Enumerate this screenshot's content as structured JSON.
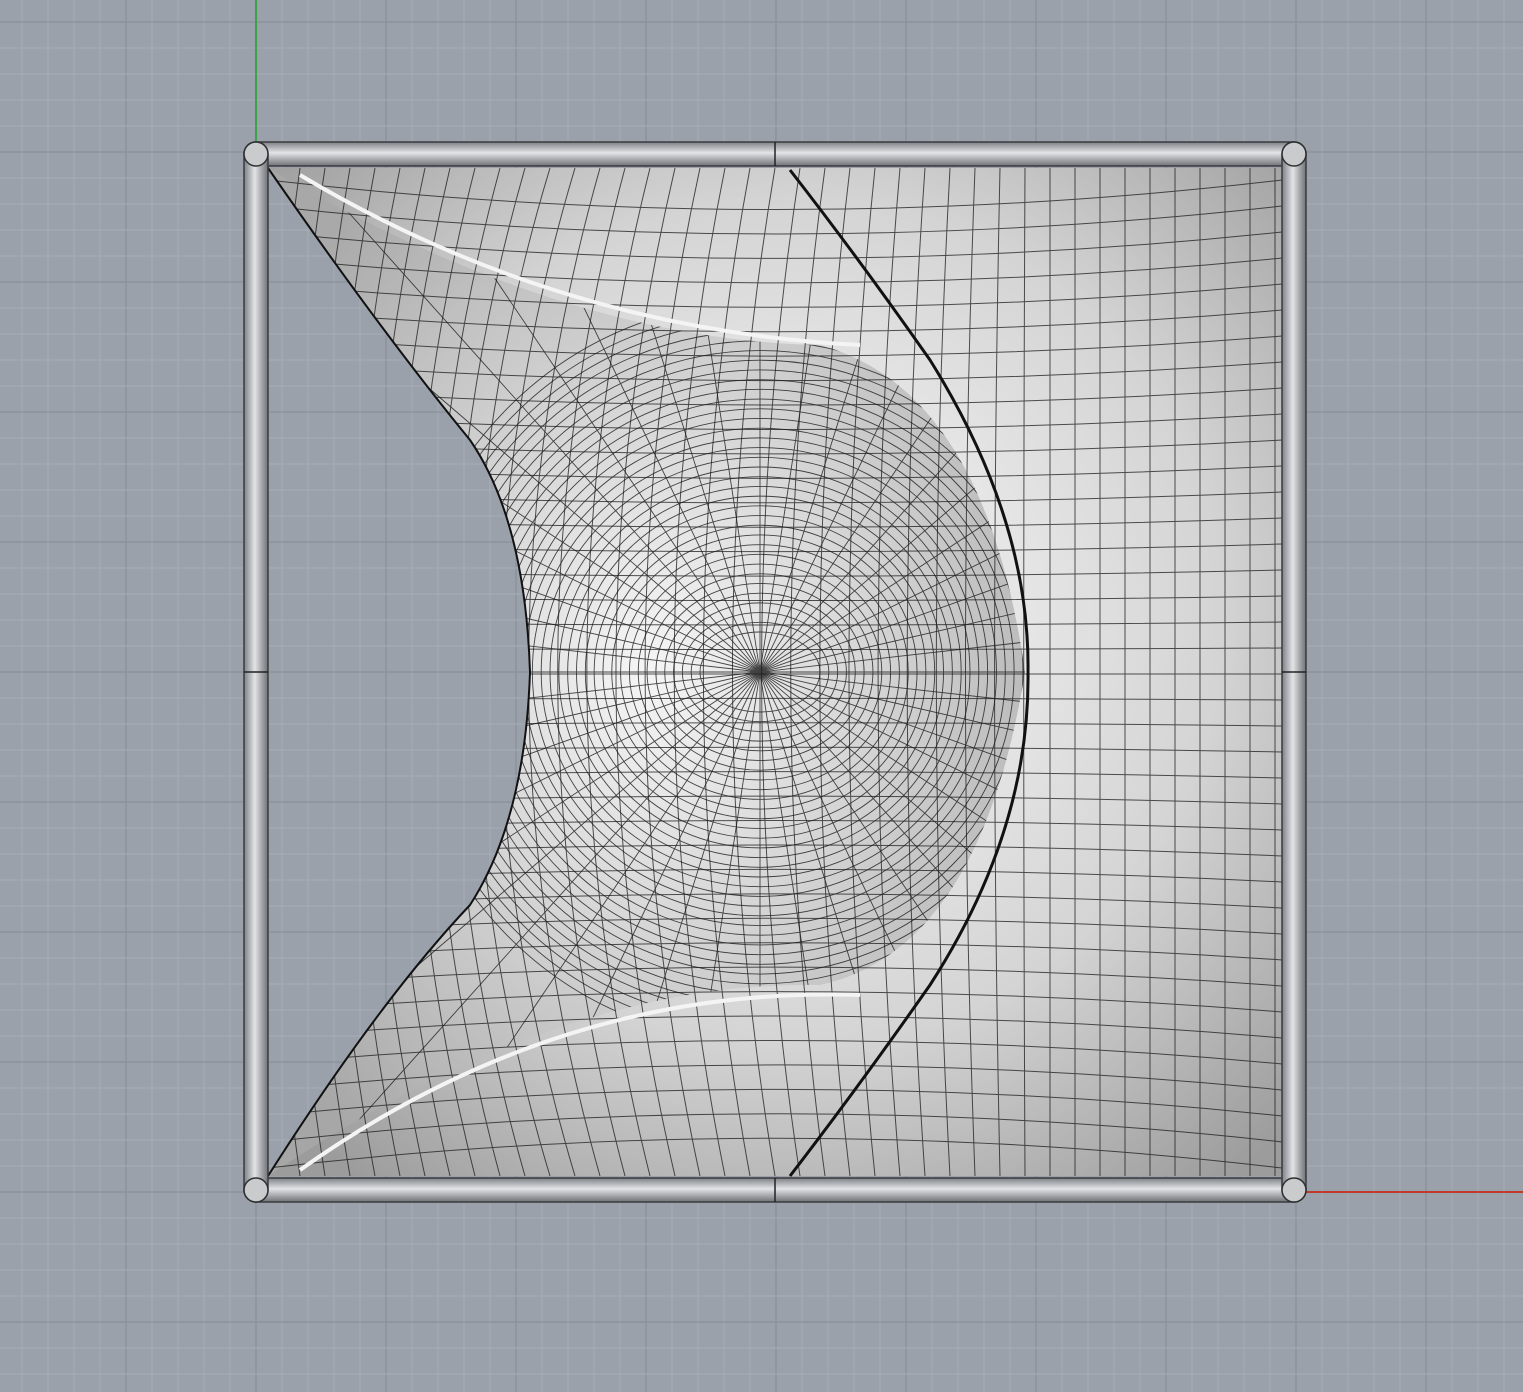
{
  "viewport": {
    "background_color": "#9aa1aa",
    "grid_minor_color": "#a6adb5",
    "grid_major_color": "#8b9199",
    "x_axis_color": "#c0392b",
    "y_axis_color": "#3aa34a",
    "frame_color": "#b9bcc0",
    "surface_color": "#e8e8e8",
    "mesh_line_color": "#1a1a1a"
  }
}
